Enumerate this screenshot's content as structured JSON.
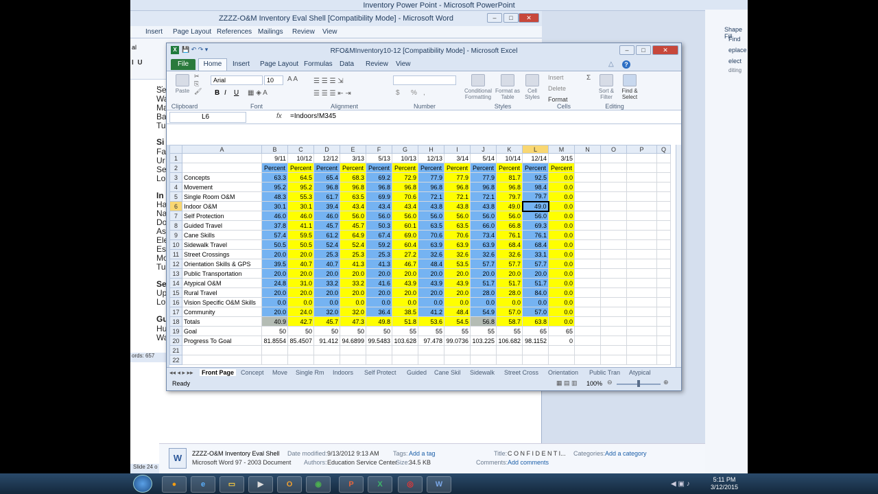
{
  "powerpoint": {
    "title": "Inventory Power Point - Microsoft PowerPoint",
    "side": {
      "shape_fill": "Shape Fill",
      "find": "Find",
      "replace": "eplace",
      "select": "elect",
      "editing": "diting"
    },
    "status": "Slide 24 o"
  },
  "word": {
    "title": "ZZZZ-O&M Inventory Eval Shell [Compatibility Mode] - Microsoft Word",
    "tabs": [
      "Insert",
      "Page Layout",
      "References",
      "Mailings",
      "Review",
      "View"
    ],
    "font_fragment": "al",
    "doc_lines": [
      "...",
      "Se",
      "Wa",
      "Ma",
      "Ba",
      "Tu",
      "Si",
      "Fa",
      "Ur",
      "Se",
      "Lo",
      "In",
      "Ha",
      "Na",
      "Do",
      "As",
      "Ele",
      "Es",
      "Mo",
      "Tu",
      "Se",
      "Up",
      "Lo",
      "Gu",
      "Hu",
      "Wa"
    ],
    "status": "ords: 657"
  },
  "explorer_details": {
    "filename": "ZZZZ-O&M Inventory Eval Shell",
    "filetype": "Microsoft Word 97 - 2003 Document",
    "modified_label": "Date modified:",
    "modified_value": "9/13/2012 9:13 AM",
    "authors_label": "Authors:",
    "authors_value": "Education Service Center",
    "tags_label": "Tags:",
    "tags_value": "Add a tag",
    "size_label": "Size:",
    "size_value": "34.5 KB",
    "title_label": "Title:",
    "title_value": "C O N F I D E N T I...",
    "categories_label": "Categories:",
    "categories_value": "Add a category",
    "comments_label": "Comments:",
    "comments_value": "Add comments"
  },
  "excel": {
    "title": "RFO&MInventory10-12  [Compatibility Mode] - Microsoft Excel",
    "tabs": {
      "file": "File",
      "home": "Home",
      "insert": "Insert",
      "page_layout": "Page Layout",
      "formulas": "Formulas",
      "data": "Data",
      "review": "Review",
      "view": "View"
    },
    "ribbon": {
      "paste": "Paste",
      "clipboard": "Clipboard",
      "font_name": "Arial",
      "font_size": "10",
      "font": "Font",
      "bold": "B",
      "italic": "I",
      "underline": "U",
      "alignment": "Alignment",
      "number": "Number",
      "cond_fmt": "Conditional Formatting",
      "format_table": "Format as Table",
      "cell_styles": "Cell Styles",
      "styles": "Styles",
      "insert": "Insert",
      "delete": "Delete",
      "format": "Format",
      "cells": "Cells",
      "sort": "Sort & Filter",
      "find": "Find & Select",
      "editing": "Editing",
      "pct": "%",
      "comma": ",",
      "dollar": "$"
    },
    "name_box": "L6",
    "fx": "fx",
    "formula": "=Indoors!M345",
    "columns": [
      "A",
      "B",
      "C",
      "D",
      "E",
      "F",
      "G",
      "H",
      "I",
      "J",
      "K",
      "L",
      "M",
      "N",
      "O",
      "P",
      "Q"
    ],
    "dates": [
      "9/11",
      "10/12",
      "12/12",
      "3/13",
      "5/13",
      "10/13",
      "12/13",
      "3/14",
      "5/14",
      "10/14",
      "12/14",
      "3/15"
    ],
    "pct_label": "Percent",
    "rows": [
      {
        "label": "Concepts",
        "v": [
          "63.3",
          "64.5",
          "65.4",
          "68.3",
          "69.2",
          "72.9",
          "77.9",
          "77.9",
          "77.9",
          "81.7",
          "92.5",
          "0.0"
        ]
      },
      {
        "label": "Movement",
        "v": [
          "95.2",
          "95.2",
          "96.8",
          "96.8",
          "96.8",
          "96.8",
          "96.8",
          "96.8",
          "96.8",
          "96.8",
          "98.4",
          "0.0"
        ]
      },
      {
        "label": "Single Room O&M",
        "v": [
          "48.3",
          "55.3",
          "61.7",
          "63.5",
          "69.9",
          "70.6",
          "72.1",
          "72.1",
          "72.1",
          "79.7",
          "79.7",
          "0.0"
        ]
      },
      {
        "label": "Indoor O&M",
        "v": [
          "30.1",
          "30.1",
          "39.4",
          "43.4",
          "43.4",
          "43.4",
          "43.8",
          "43.8",
          "43.8",
          "49.0",
          "49.0",
          "0.0"
        ]
      },
      {
        "label": "Self Protection",
        "v": [
          "46.0",
          "46.0",
          "46.0",
          "56.0",
          "56.0",
          "56.0",
          "56.0",
          "56.0",
          "56.0",
          "56.0",
          "56.0",
          "0.0"
        ]
      },
      {
        "label": "Guided Travel",
        "v": [
          "37.8",
          "41.1",
          "45.7",
          "45.7",
          "50.3",
          "60.1",
          "63.5",
          "63.5",
          "66.0",
          "66.8",
          "69.3",
          "0.0"
        ]
      },
      {
        "label": "Cane Skills",
        "v": [
          "57.4",
          "59.5",
          "61.2",
          "64.9",
          "67.4",
          "69.0",
          "70.6",
          "70.6",
          "73.4",
          "76.1",
          "76.1",
          "0.0"
        ]
      },
      {
        "label": "Sidewalk Travel",
        "v": [
          "50.5",
          "50.5",
          "52.4",
          "52.4",
          "59.2",
          "60.4",
          "63.9",
          "63.9",
          "63.9",
          "68.4",
          "68.4",
          "0.0"
        ]
      },
      {
        "label": "Street Crossings",
        "v": [
          "20.0",
          "20.0",
          "25.3",
          "25.3",
          "25.3",
          "27.2",
          "32.6",
          "32.6",
          "32.6",
          "32.6",
          "33.1",
          "0.0"
        ]
      },
      {
        "label": "Orientation Skills & GPS",
        "v": [
          "39.5",
          "40.7",
          "40.7",
          "41.3",
          "41.3",
          "46.7",
          "48.4",
          "53.5",
          "57.7",
          "57.7",
          "57.7",
          "0.0"
        ]
      },
      {
        "label": "Public Transportation",
        "v": [
          "20.0",
          "20.0",
          "20.0",
          "20.0",
          "20.0",
          "20.0",
          "20.0",
          "20.0",
          "20.0",
          "20.0",
          "20.0",
          "0.0"
        ]
      },
      {
        "label": "Atypical O&M",
        "v": [
          "24.8",
          "31.0",
          "33.2",
          "33.2",
          "41.6",
          "43.9",
          "43.9",
          "43.9",
          "51.7",
          "51.7",
          "51.7",
          "0.0"
        ]
      },
      {
        "label": "Rural Travel",
        "v": [
          "20.0",
          "20.0",
          "20.0",
          "20.0",
          "20.0",
          "20.0",
          "20.0",
          "20.0",
          "28.0",
          "28.0",
          "84.0",
          "0.0"
        ]
      },
      {
        "label": "Vision Specific O&M Skills",
        "v": [
          "0.0",
          "0.0",
          "0.0",
          "0.0",
          "0.0",
          "0.0",
          "0.0",
          "0.0",
          "0.0",
          "0.0",
          "0.0",
          "0.0"
        ]
      },
      {
        "label": "Community",
        "v": [
          "20.0",
          "24.0",
          "32.0",
          "32.0",
          "36.4",
          "38.5",
          "41.2",
          "48.4",
          "54.9",
          "57.0",
          "57.0",
          "0.0"
        ]
      },
      {
        "label": "Totals",
        "v": [
          "40.9",
          "42.7",
          "45.7",
          "47.3",
          "49.8",
          "51.8",
          "53.6",
          "54.5",
          "56.8",
          "58.7",
          "63.8",
          "0.0"
        ]
      },
      {
        "label": "Goal",
        "v": [
          "50",
          "50",
          "50",
          "50",
          "50",
          "55",
          "55",
          "55",
          "55",
          "55",
          "65",
          "65"
        ]
      },
      {
        "label": "Progress To Goal",
        "v": [
          "81.8554",
          "85.4507",
          "91.412",
          "94.6899",
          "99.5483",
          "103.628",
          "97.478",
          "99.0736",
          "103.225",
          "106.682",
          "98.1152",
          "0"
        ]
      }
    ],
    "sheet_tabs": [
      "Front Page",
      "Concept",
      "Move",
      "Single Rm",
      "Indoors",
      "Self Protect",
      "Guided",
      "Cane Skil",
      "Sidewalk",
      "Street Cross",
      "Orientation",
      "Public Tran",
      "Atypical"
    ],
    "status_ready": "Ready",
    "zoom": "100%"
  },
  "taskbar": {
    "time": "5:11 PM",
    "date": "3/12/2015"
  },
  "colors": {
    "blue_cells": "#75b3f2",
    "yellow_cells": "#ffff00",
    "totals_gray": "#b4bcb4",
    "selected_header": "#f9d772"
  }
}
